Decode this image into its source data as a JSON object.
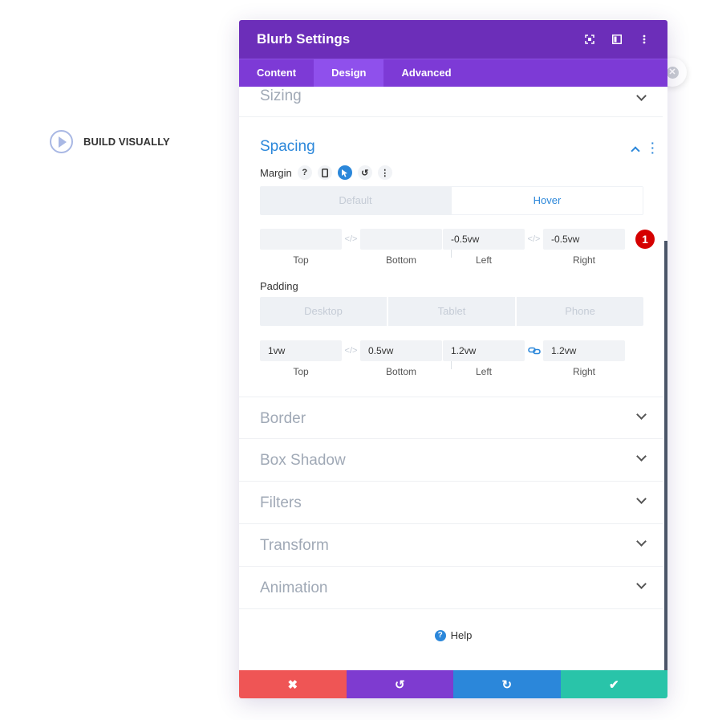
{
  "page": {
    "build_label": "BUILD VISUALLY",
    "build_icon": "play-icon"
  },
  "modal": {
    "title": "Blurb Settings",
    "header_icons": [
      "expand-icon",
      "sidebar-icon",
      "more-icon"
    ],
    "tabs": [
      "Content",
      "Design",
      "Advanced"
    ],
    "active_tab": "Design",
    "colors": {
      "header": "#6c2eb9",
      "tabs": "#7d3ad6",
      "accent": "#2b87da",
      "cancel": "#ef5555",
      "undo": "#7e3bd0",
      "redo": "#2b87da",
      "save": "#29c4a9",
      "badge": "#d50000"
    }
  },
  "sections": {
    "sizing": "Sizing",
    "spacing": "Spacing",
    "border": "Border",
    "box_shadow": "Box Shadow",
    "filters": "Filters",
    "transform": "Transform",
    "animation": "Animation"
  },
  "spacing": {
    "margin_label": "Margin",
    "margin_tabs": [
      "Default",
      "Hover"
    ],
    "margin_selected": "Hover",
    "margin_values": {
      "top": "",
      "bottom": "",
      "left": "-0.5vw",
      "right": "-0.5vw"
    },
    "padding_label": "Padding",
    "padding_tabs": [
      "Desktop",
      "Tablet",
      "Phone"
    ],
    "padding_values": {
      "top": "1vw",
      "bottom": "0.5vw",
      "left": "1.2vw",
      "right": "1.2vw"
    },
    "field_labels": {
      "top": "Top",
      "bottom": "Bottom",
      "left": "Left",
      "right": "Right"
    },
    "badge_number": "1"
  },
  "help_label": "Help",
  "footer": {
    "cancel_icon": "✖",
    "undo_icon": "↺",
    "redo_icon": "↻",
    "save_icon": "✔"
  }
}
